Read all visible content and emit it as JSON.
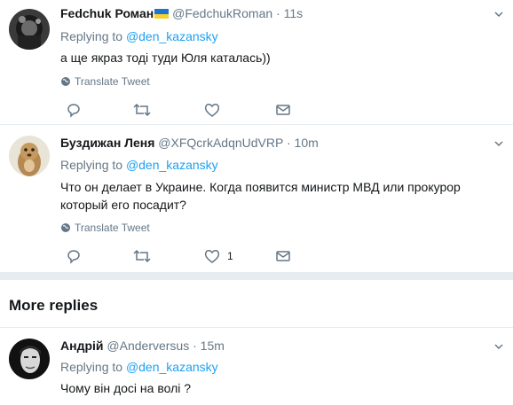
{
  "replies": [
    {
      "name": "Fedchuk Роман",
      "handle": "@FedchukRoman",
      "dot": "·",
      "time": "11s",
      "replying_prefix": "Replying to",
      "replying_to": "@den_kazansky",
      "text": "а ще якраз тоді туди Юля каталась))",
      "translate": "Translate Tweet",
      "likes": ""
    },
    {
      "name": "Буздижан Леня",
      "handle": "@XFQcrkAdqnUdVRP",
      "dot": "·",
      "time": "10m",
      "replying_prefix": "Replying to",
      "replying_to": "@den_kazansky",
      "text": "Что он делает в Украине. Когда появится министр МВД или прокурор который его посадит?",
      "translate": "Translate Tweet",
      "likes": "1"
    },
    {
      "name": "Андрій",
      "handle": "@Anderversus",
      "dot": "·",
      "time": "15m",
      "replying_prefix": "Replying to",
      "replying_to": "@den_kazansky",
      "text": "Чому він досі на волі ?"
    }
  ],
  "more_replies": "More replies",
  "colors": {
    "link": "#1da1f2",
    "muted": "#657786",
    "divider": "#e6ecf0",
    "flag_blue": "#1d75d3",
    "flag_yellow": "#f7d22e"
  },
  "icons": [
    "reply-icon",
    "retweet-icon",
    "like-icon",
    "message-icon",
    "globe-icon",
    "chevron-down-icon"
  ]
}
